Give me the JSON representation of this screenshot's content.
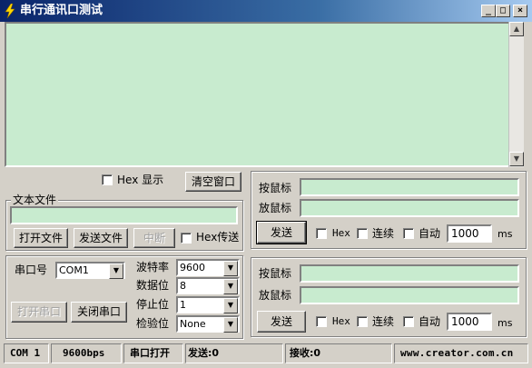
{
  "window": {
    "title": "串行通讯口测试",
    "minimize": "_",
    "maximize": "□",
    "close": "×"
  },
  "receive_panel": {
    "hex_display_label": "Hex 显示",
    "clear_button": "清空窗口"
  },
  "file_group": {
    "legend": "文本文件",
    "open_file": "打开文件",
    "send_file": "发送文件",
    "interrupt": "中断",
    "hex_transfer_label": "Hex传送"
  },
  "port_settings": {
    "port_label": "串口号",
    "port_value": "COM1",
    "baud_label": "波特率",
    "baud_value": "9600",
    "data_bits_label": "数据位",
    "data_bits_value": "8",
    "stop_bits_label": "停止位",
    "stop_bits_value": "1",
    "parity_label": "检验位",
    "parity_value": "None",
    "open_port": "打开串口",
    "close_port": "关闭串口"
  },
  "send_panel_1": {
    "field1_label": "按鼠标",
    "field2_label": "放鼠标",
    "send_button": "发送",
    "hex_label": "Hex",
    "continuous_label": "连续",
    "auto_label": "自动",
    "interval": "1000",
    "unit": "ms"
  },
  "send_panel_2": {
    "field1_label": "按鼠标",
    "field2_label": "放鼠标",
    "send_button": "发送",
    "hex_label": "Hex",
    "continuous_label": "连续",
    "auto_label": "自动",
    "interval": "1000",
    "unit": "ms"
  },
  "statusbar": {
    "port": "COM 1",
    "baud": "9600bps",
    "port_state": "串口打开",
    "sent": "发送:0",
    "received": "接收:0",
    "website": "www.creator.com.cn"
  },
  "colors": {
    "field_green": "#c8ebcf",
    "titlebar_start": "#0a246a",
    "face": "#d4d0c8"
  },
  "icons": {
    "app": "lightning-icon",
    "scroll_up": "arrow-up-icon",
    "scroll_down": "arrow-down-icon",
    "dropdown": "chevron-down-icon"
  }
}
